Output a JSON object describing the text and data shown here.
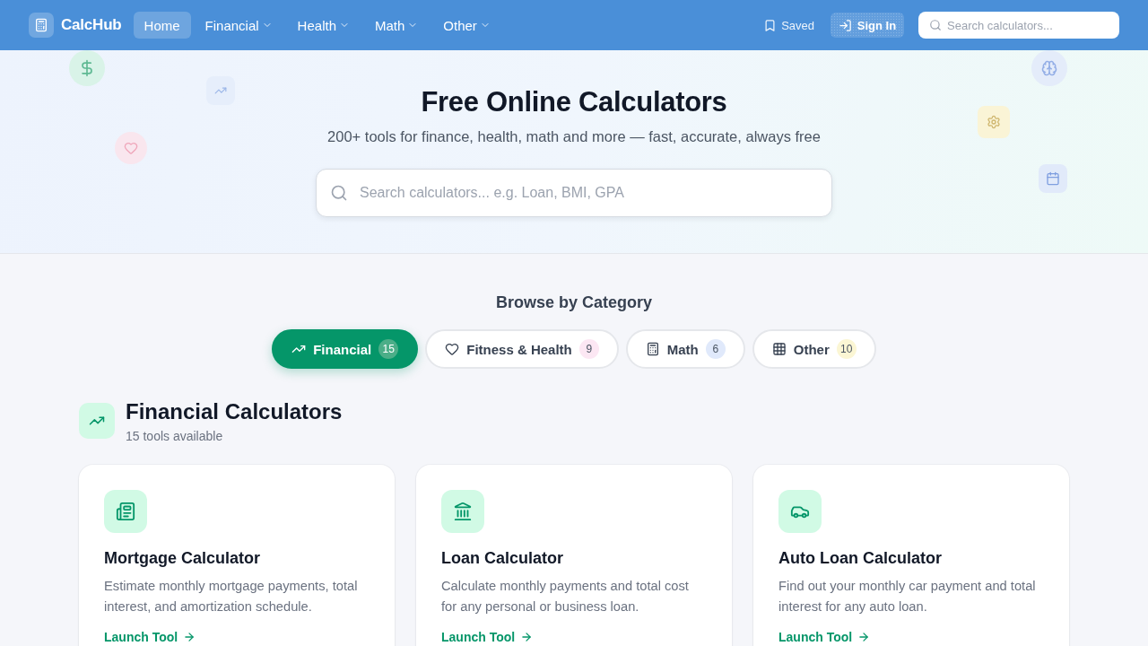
{
  "nav": {
    "logo": "CalcHub",
    "items": [
      {
        "label": "Home",
        "selected": true,
        "dropdown": false
      },
      {
        "label": "Financial",
        "selected": false,
        "dropdown": true
      },
      {
        "label": "Health",
        "selected": false,
        "dropdown": true
      },
      {
        "label": "Math",
        "selected": false,
        "dropdown": true
      },
      {
        "label": "Other",
        "selected": false,
        "dropdown": true
      }
    ],
    "saved": "Saved",
    "sign_in": "Sign In",
    "search": {
      "placeholder": "Search calculators..."
    }
  },
  "hero": {
    "title": "Free Online Calculators",
    "subtitle": "200+ tools for finance, health, math and more — fast, accurate, always free",
    "search": {
      "placeholder": "Search calculators... e.g. Loan, BMI, GPA"
    }
  },
  "categories": {
    "heading": "Browse by Category",
    "items": [
      {
        "label": "Financial",
        "count": "15",
        "selected": true,
        "color": "#4cae88"
      },
      {
        "label": "Fitness & Health",
        "count": "9",
        "selected": false,
        "color": "#fce7f3"
      },
      {
        "label": "Math",
        "count": "6",
        "selected": false,
        "color": "#e0e9fb"
      },
      {
        "label": "Other",
        "count": "10",
        "selected": false,
        "color": "#fbf6d4"
      }
    ]
  },
  "section": {
    "title": "Financial Calculators",
    "subtitle": "15 tools available",
    "cards": [
      {
        "title": "Mortgage Calculator",
        "description": "Estimate monthly mortgage payments, total interest, and amortization schedule.",
        "link": "Launch Tool"
      },
      {
        "title": "Loan Calculator",
        "description": "Calculate monthly payments and total cost for any personal or business loan.",
        "link": "Launch Tool"
      },
      {
        "title": "Auto Loan Calculator",
        "description": "Find out your monthly car payment and total interest for any auto loan.",
        "link": "Launch Tool"
      }
    ]
  }
}
